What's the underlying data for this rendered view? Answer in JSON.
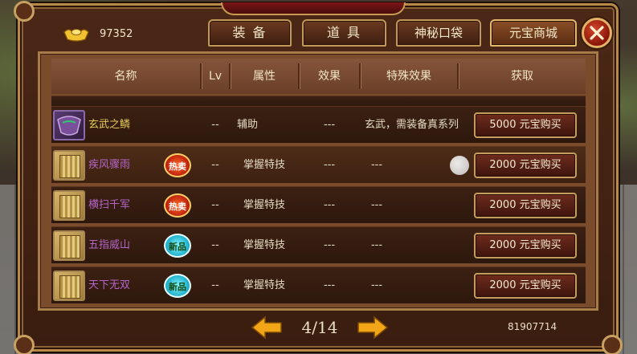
{
  "currency": {
    "icon": "gold-ingot-icon",
    "amount": "97352"
  },
  "tabs": [
    {
      "label": "装 备",
      "active": false
    },
    {
      "label": "道 具",
      "active": false
    },
    {
      "label": "神秘口袋",
      "active": false
    },
    {
      "label": "元宝商城",
      "active": true
    }
  ],
  "close": {
    "icon": "close-icon"
  },
  "table": {
    "headers": [
      "名称",
      "Lv",
      "属性",
      "效果",
      "特殊效果",
      "获取"
    ],
    "rows": [
      {
        "name": "玄武之鳞",
        "color": "#e6c95a",
        "icon": "armor-icon",
        "badge": "",
        "lv": "--",
        "attr": "辅助",
        "effect": "---",
        "special": "玄武，需装备真系列",
        "buy": "5000  元宝购买"
      },
      {
        "name": "疾风骤雨",
        "color": "#b565c9",
        "icon": "skill-book-icon",
        "badge": "热卖",
        "lv": "--",
        "attr": "掌握特技",
        "effect": "---",
        "special": "---",
        "buy": "2000  元宝购买",
        "selected": true
      },
      {
        "name": "横扫千军",
        "color": "#b565c9",
        "icon": "skill-book-icon",
        "badge": "热卖",
        "lv": "--",
        "attr": "掌握特技",
        "effect": "---",
        "special": "---",
        "buy": "2000  元宝购买"
      },
      {
        "name": "五指威山",
        "color": "#b565c9",
        "icon": "skill-book-icon",
        "badge": "新品",
        "lv": "--",
        "attr": "掌握特技",
        "effect": "---",
        "special": "---",
        "buy": "2000  元宝购买"
      },
      {
        "name": "天下无双",
        "color": "#b565c9",
        "icon": "skill-book-icon",
        "badge": "新品",
        "lv": "--",
        "attr": "掌握特技",
        "effect": "---",
        "special": "---",
        "buy": "2000  元宝购买"
      }
    ]
  },
  "pagination": {
    "current": "4/14",
    "prev_icon": "arrow-left-icon",
    "next_icon": "arrow-right-icon"
  },
  "player_id": "81907714",
  "colors": {
    "accent_gold": "#c49c5e",
    "hot_badge": "#b81a08",
    "new_badge": "#17a9c7"
  }
}
